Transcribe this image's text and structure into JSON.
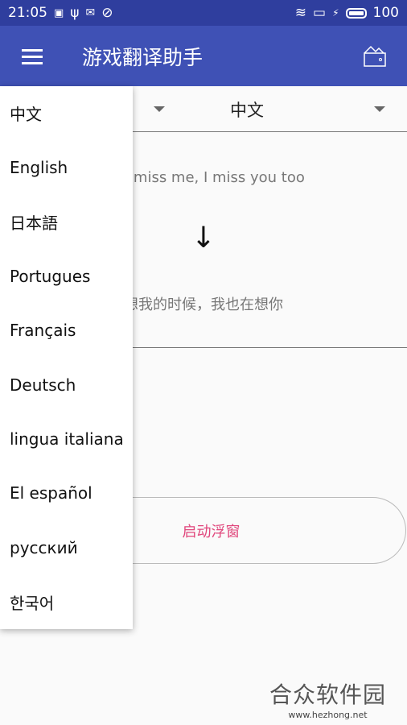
{
  "status_bar": {
    "time": "21:05",
    "battery": "100"
  },
  "app_bar": {
    "title": "游戏翻译助手",
    "menu_icon": "hamburger-icon",
    "action_icon": "wallet-icon"
  },
  "translator": {
    "source_language": "",
    "target_language": "中文",
    "source_text": "you miss me, I miss you too",
    "arrow": "↓",
    "result_text": "想我的时候，我也在想你",
    "float_button": "启动浮窗"
  },
  "language_dropdown": {
    "options": [
      "中文",
      "English",
      "日本語",
      "Portugues",
      "Français",
      "Deutsch",
      "lingua italiana",
      "El español",
      "русский",
      "한국어"
    ]
  },
  "colors": {
    "status_bar": "#2f3e9e",
    "app_bar": "#3f51b5",
    "accent": "#e0457b"
  },
  "watermark": {
    "name": "合众软件园",
    "url": "www.hezhong.net"
  }
}
